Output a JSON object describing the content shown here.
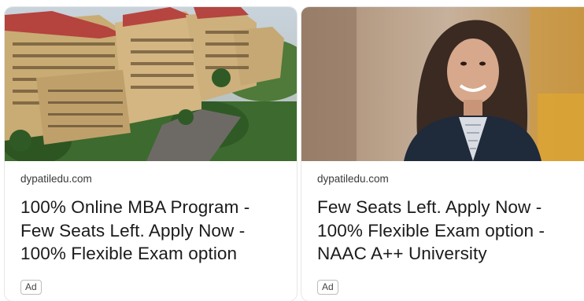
{
  "cards": [
    {
      "domain": "dypatiledu.com",
      "headline_lines": [
        "100% Online MBA Program -",
        "Few Seats Left. Apply Now -",
        "100% Flexible Exam option"
      ],
      "badge": "Ad",
      "image_subject": "campus-aerial-photo"
    },
    {
      "domain": "dypatiledu.com",
      "headline_lines": [
        "Few Seats Left. Apply Now -",
        "100% Flexible Exam option -",
        "NAAC A++ University"
      ],
      "badge": "Ad",
      "image_subject": "smiling-student-portrait"
    }
  ],
  "colors": {
    "card_border": "#e6e6e6",
    "headline_text": "#1b1b1b",
    "domain_text": "#3a3a3a",
    "badge_border": "#bdbdbd"
  }
}
